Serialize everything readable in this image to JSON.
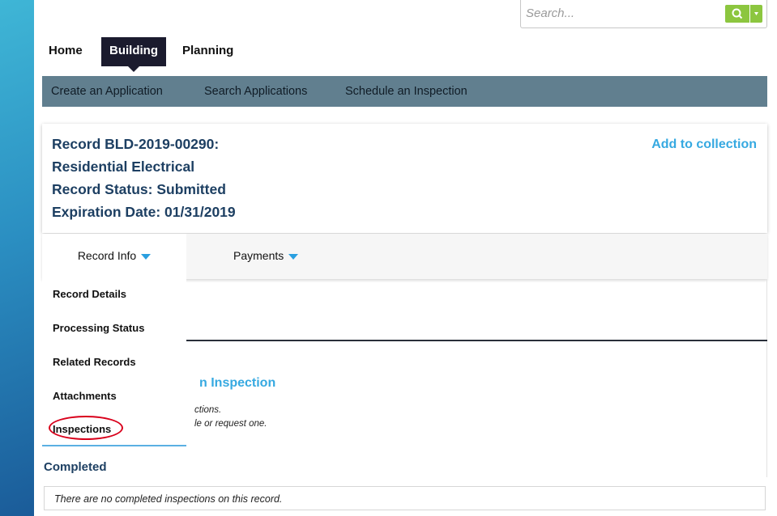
{
  "search": {
    "placeholder": "Search..."
  },
  "top_nav": {
    "items": [
      "Home",
      "Building",
      "Planning"
    ],
    "active": "Building"
  },
  "sub_nav": {
    "items": [
      "Create an Application",
      "Search Applications",
      "Schedule an Inspection"
    ]
  },
  "record": {
    "line1": "Record BLD-2019-00290:",
    "line2": "Residential Electrical",
    "line3": "Record Status: Submitted",
    "line4": "Expiration Date: 01/31/2019",
    "add_to_collection": "Add to collection"
  },
  "tabs": {
    "record_info": "Record Info",
    "payments": "Payments"
  },
  "dropdown": {
    "items": [
      "Record Details",
      "Processing Status",
      "Related Records",
      "Attachments",
      "Inspections"
    ],
    "highlighted": "Inspections"
  },
  "content": {
    "schedule_title_partial": "n Inspection",
    "note1_partial": "ctions.",
    "note2_partial": "le or request one.",
    "completed_heading": "Completed",
    "no_completed_text": "There are no completed inspections on this record."
  },
  "colors": {
    "accent_blue": "#36a9e1",
    "nav_bar": "#617f8f",
    "search_green": "#8cc63f",
    "annotation_red": "#d9001b"
  }
}
